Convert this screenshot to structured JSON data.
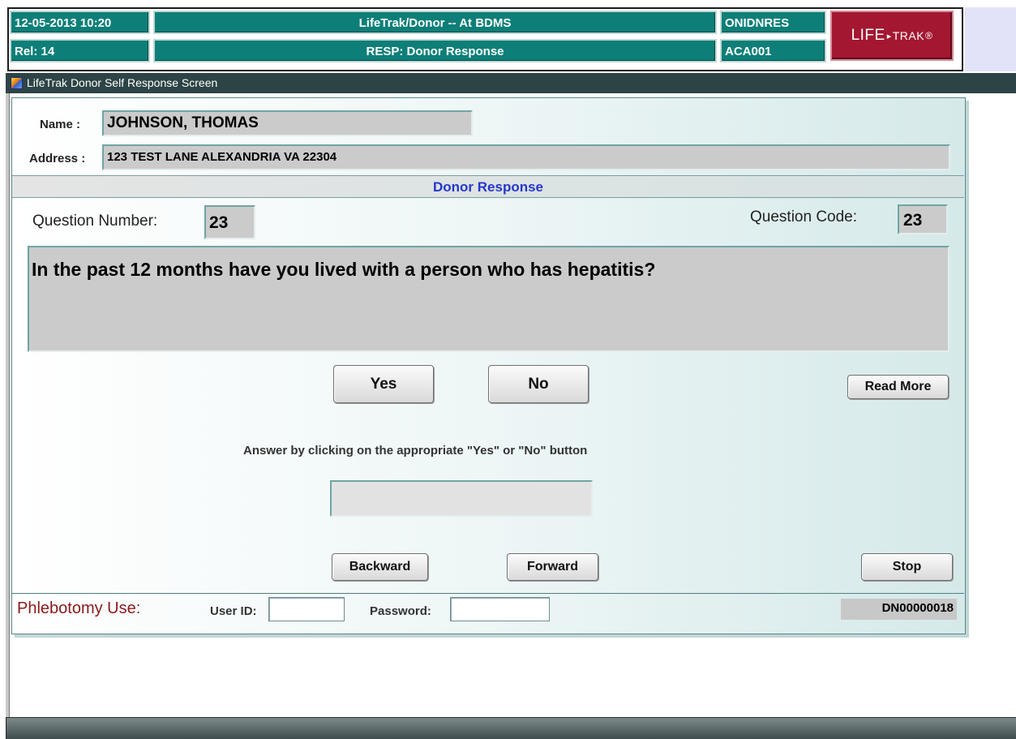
{
  "header": {
    "datetime": "12-05-2013  10:20",
    "release": "Rel: 14",
    "app_title": "LifeTrak/Donor -- At BDMS",
    "screen_title": "RESP: Donor Response",
    "form_code": "ONIDNRES",
    "user_code": "ACA001",
    "logo": {
      "life": "LIFE",
      "arrow": "▸",
      "trak": "TRAK",
      "mark": "®"
    }
  },
  "window": {
    "title": "LifeTrak Donor Self Response Screen"
  },
  "donor": {
    "name_label": "Name :",
    "name": "JOHNSON, THOMAS",
    "address_label": "Address :",
    "address": "123 TEST LANE  ALEXANDRIA VA 22304"
  },
  "section": {
    "title": "Donor Response"
  },
  "question": {
    "number_label": "Question Number:",
    "number": "23",
    "code_label": "Question Code:",
    "code": "23",
    "text": "In the past 12 months have you lived with a person who has hepatitis?"
  },
  "buttons": {
    "yes": "Yes",
    "no": "No",
    "read_more": "Read More",
    "backward": "Backward",
    "forward": "Forward",
    "stop": "Stop"
  },
  "instruction": "Answer by clicking on the appropriate \"Yes\"  or  \"No\" button",
  "answer": {
    "value": ""
  },
  "footer": {
    "phlebotomy_label": "Phlebotomy Use:",
    "user_id_label": "User ID:",
    "user_id": "",
    "password_label": "Password:",
    "password": "",
    "donor_number": "DN00000018"
  },
  "colors": {
    "header_teal": "#0d7f78",
    "logo_red": "#a31731",
    "section_title_blue": "#2538c9",
    "phlebotomy_red": "#8b1a1a",
    "titlebar": "#2d4446"
  }
}
